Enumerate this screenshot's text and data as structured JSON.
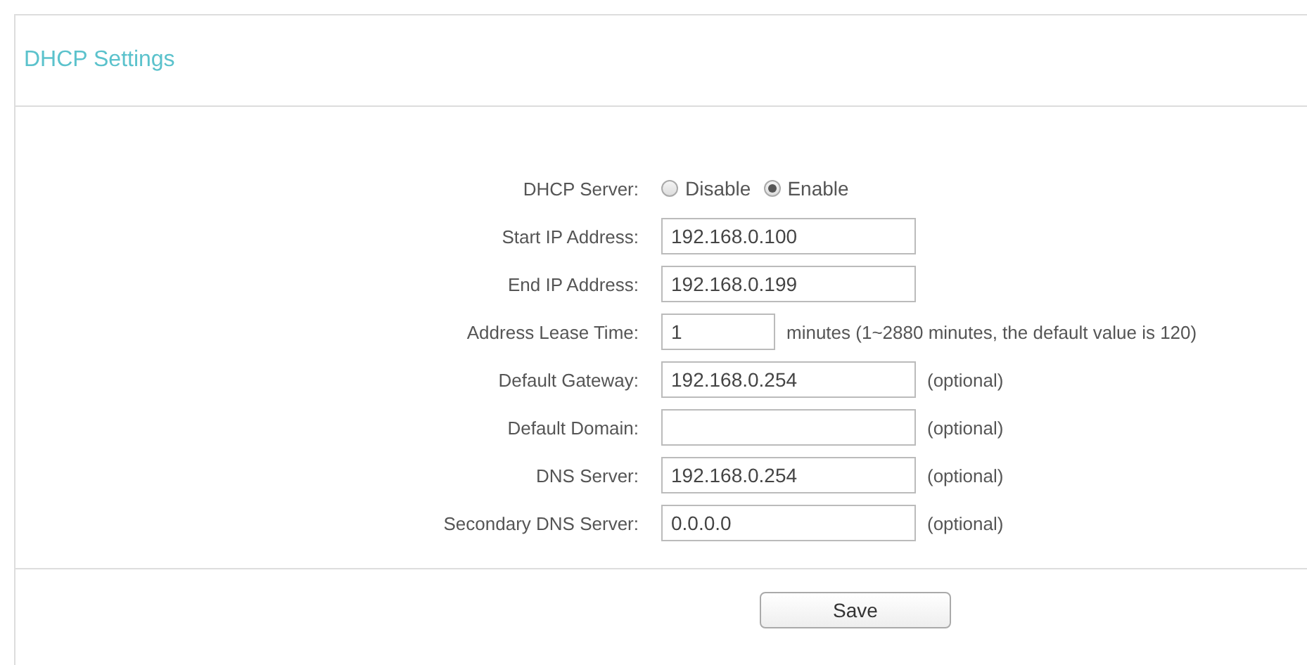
{
  "panel": {
    "title": "DHCP Settings"
  },
  "rows": [
    {
      "kind": "radio",
      "label": "DHCP Server:",
      "options": [
        {
          "label": "Disable",
          "selected": false
        },
        {
          "label": "Enable",
          "selected": true
        }
      ]
    },
    {
      "kind": "field",
      "label": "Start IP Address:",
      "value": "192.168.0.100"
    },
    {
      "kind": "field",
      "label": "End IP Address:",
      "value": "192.168.0.199"
    },
    {
      "kind": "short",
      "label": "Address Lease Time:",
      "value": "1",
      "note": "minutes (1~2880 minutes, the default value is 120)"
    },
    {
      "kind": "field",
      "label": "Default Gateway:",
      "value": "192.168.0.254",
      "note": "(optional)"
    },
    {
      "kind": "field",
      "label": "Default Domain:",
      "note": "(optional)"
    },
    {
      "kind": "field",
      "label": "DNS Server:",
      "value": "192.168.0.254",
      "note": "(optional)"
    },
    {
      "kind": "field",
      "label": "Secondary DNS Server:",
      "value": "0.0.0.0",
      "note": "(optional)"
    }
  ],
  "save_button": "Save"
}
